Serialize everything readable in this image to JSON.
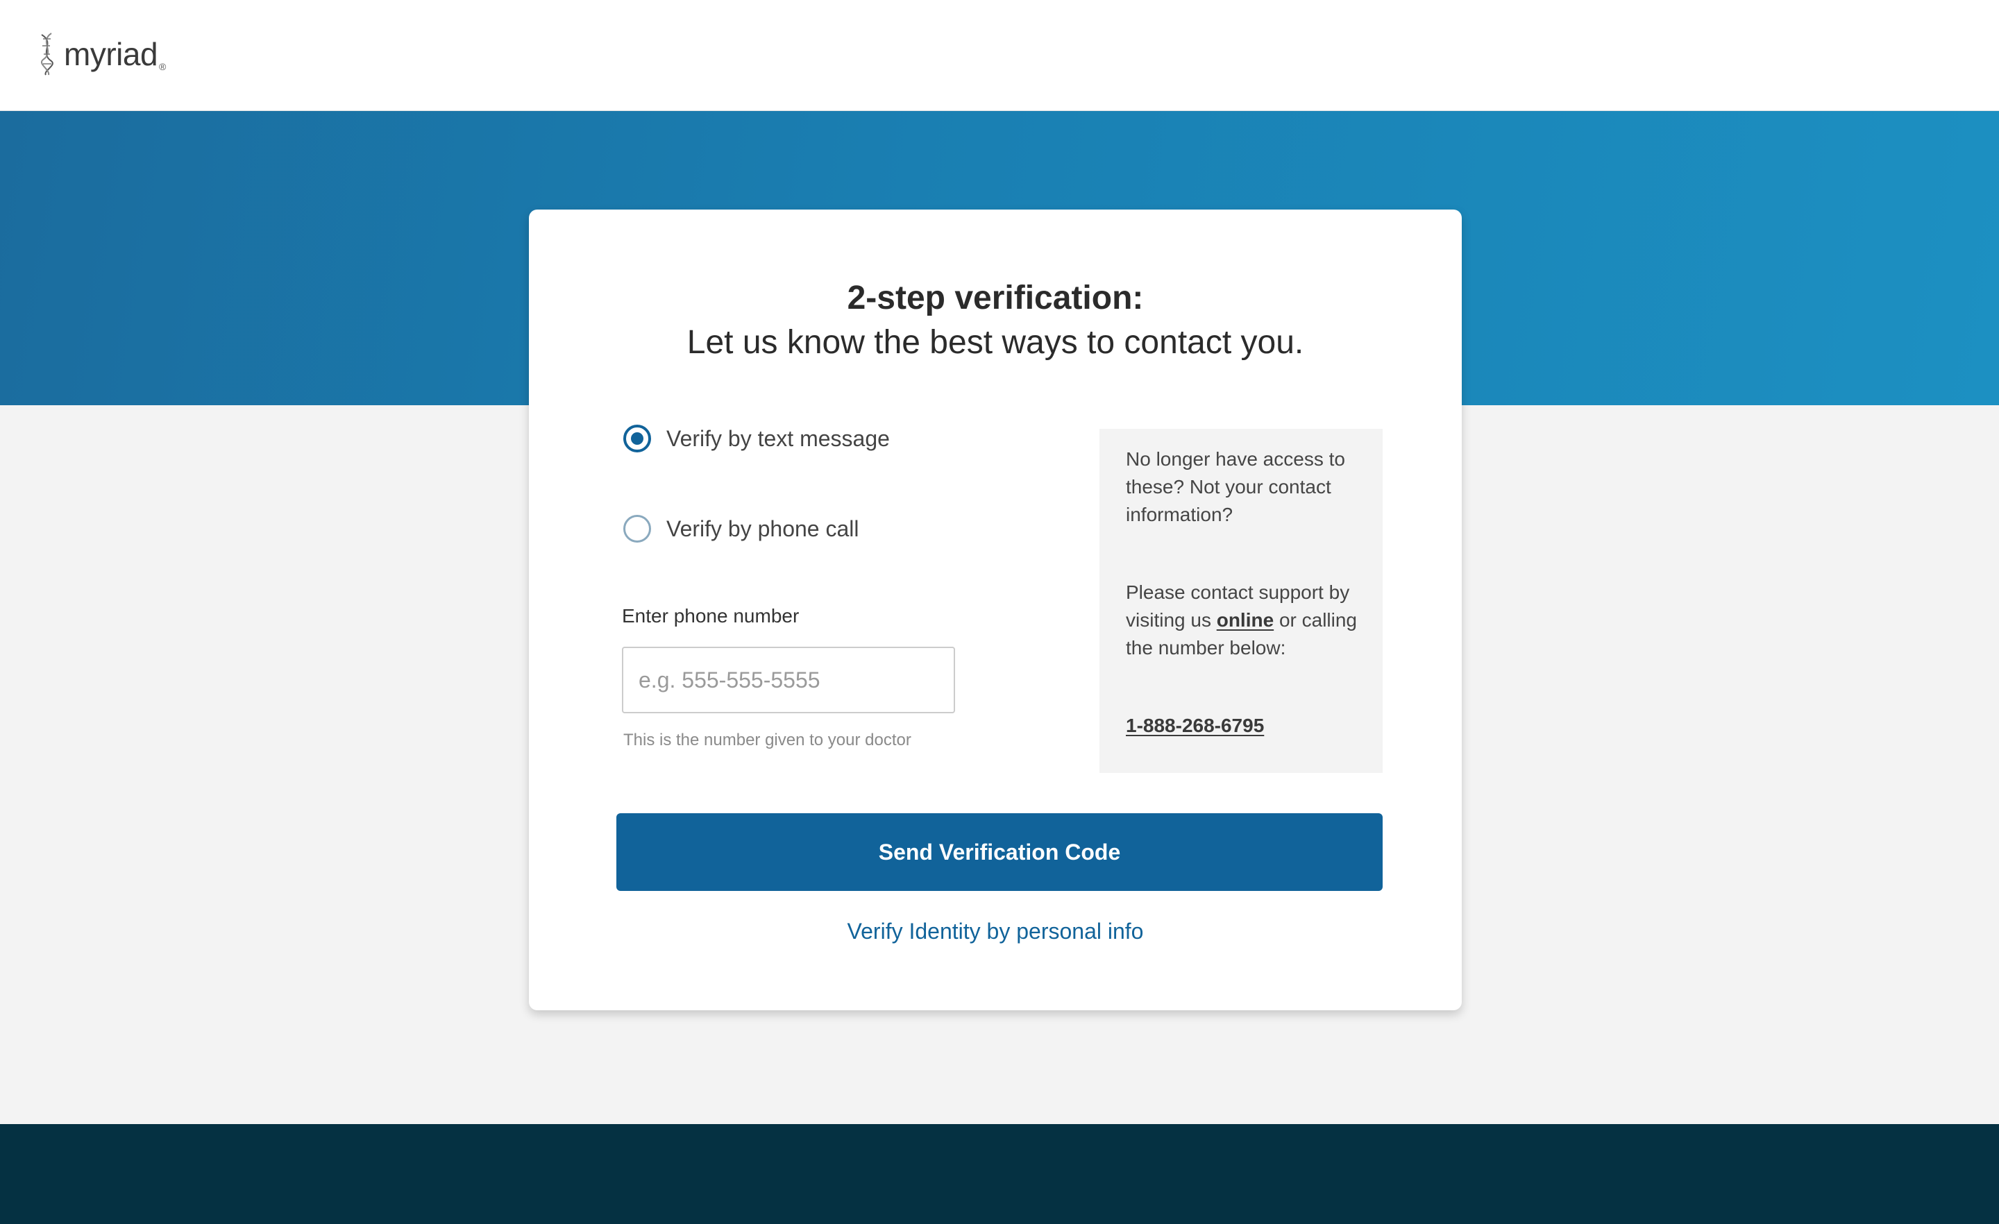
{
  "header": {
    "logo_text": "myriad",
    "logo_mark": "®"
  },
  "card": {
    "title": "2-step verification:",
    "subtitle": "Let us know the best ways to contact you.",
    "options": [
      {
        "label": "Verify by text message",
        "selected": true
      },
      {
        "label": "Verify by phone call",
        "selected": false
      }
    ],
    "phone": {
      "label": "Enter phone number",
      "placeholder": "e.g. 555-555-5555",
      "value": "",
      "hint": "This is the number given to your doctor"
    },
    "support": {
      "para1": "No longer have access to these? Not your contact information?",
      "para2_before": "Please contact support by visiting us",
      "para2_link": "online",
      "para2_after": "or calling the number below:",
      "phone_number": "1-888-268-6795"
    },
    "send_button": "Send Verification Code",
    "alt_link": "Verify Identity by personal info"
  },
  "colors": {
    "brand_blue": "#11639a",
    "hero_start": "#1b6c9e",
    "hero_end": "#1c90c2",
    "footer": "#053142",
    "background": "#f3f3f3"
  },
  "icons": {
    "logo": "dna-helix-icon",
    "radio_selected": "radio-checked-icon",
    "radio_unselected": "radio-unchecked-icon"
  }
}
